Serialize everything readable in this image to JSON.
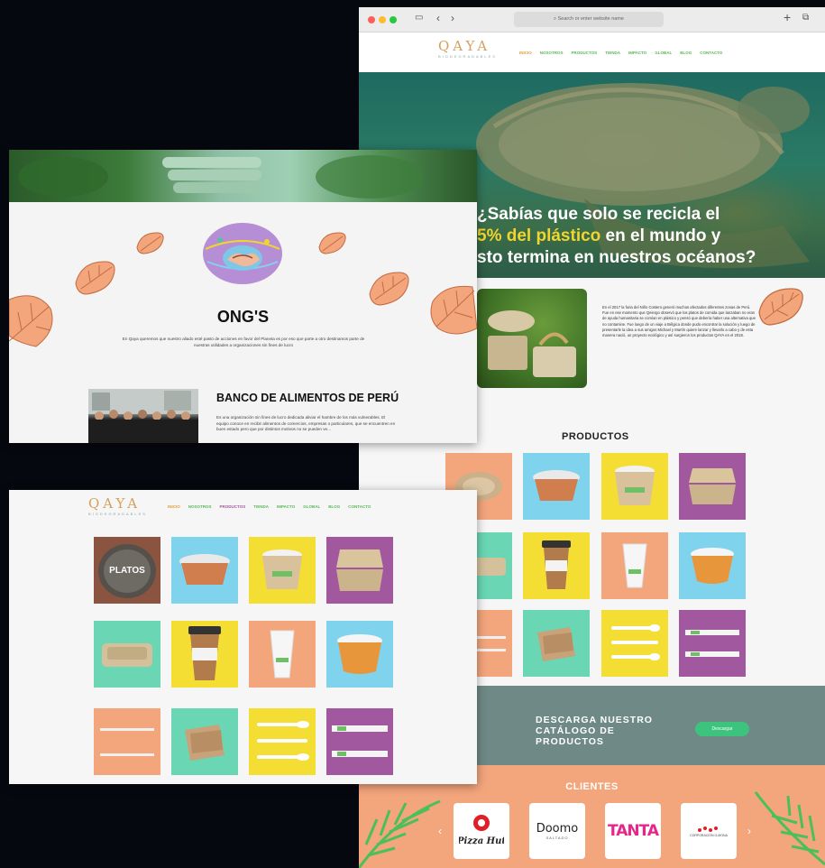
{
  "browser": {
    "address": "Search or enter website name",
    "icons": [
      "sidebar-icon",
      "back-icon",
      "forward-icon",
      "new-tab-icon",
      "tabs-overview-icon"
    ]
  },
  "site": {
    "logo": "QAYA",
    "logo_sub": "BIODEGRADABLES",
    "nav": [
      "INICIO",
      "NOSOTROS",
      "PRODUCTOS",
      "TIENDA",
      "IMPACTO",
      "GLOBAL",
      "BLOG",
      "CONTACTO"
    ],
    "accent": "#58b957",
    "accent_active": "#e69a34"
  },
  "hero": {
    "line1": "¿Sabías que solo se recicla el",
    "highlight": "5% del plástico",
    "line2_rest": " en el mundo y",
    "line3": "sto termina en nuestros océanos?",
    "highlight_color": "#f2d52c"
  },
  "about": {
    "text": "En el 2017 la furia del Niño Costero generó muchos afectados diferentes zonas de Perú. Fue en ese momento que Qeiergo observó que los platos de comida que lanzaban no eran de ayuda humanitaria se comían en plástico y pensó que debería haber una alternativa que no contamine. Fue luego de un viaje a Bélgica donde pudo encontrar la solución y luego de presentarle la idea a sus amigos Michael y Martín quiere lanzar y llevarlo a cabo y de esta manera nació, un proyecto ecológico y así surgieron los productos QAYA en el 2018."
  },
  "products": {
    "title": "PRODUCTOS",
    "platos_label": "PLATOS",
    "tile_colors": [
      "#f3a57c",
      "#7fd3ec",
      "#f5de33",
      "#a2589e",
      "#6ad6b4",
      "#f5de33",
      "#f3a57c",
      "#7fd3ec",
      "#f3a57c",
      "#6ad6b4",
      "#f5de33",
      "#a2589e"
    ]
  },
  "catalog": {
    "text": "DESCARGA NUESTRO\nCATÁLOGO DE\nPRODUCTOS",
    "button": "Descargar"
  },
  "clients": {
    "title": "CLIENTES",
    "logos": [
      "Pizza Hut",
      "Doomo",
      "Tanta",
      "Corporación G-Mona"
    ],
    "doomo_sub": "SALTADO",
    "tanta_logo": "TANTA",
    "corp_logo": "CORPORACIÓN G-MONA"
  },
  "ong": {
    "title": "ONG'S",
    "description": "En Qaya queremos que nuestro aliado esté pasto de acciones en favor del Planeta es por eso que parte a otro destinamos parte de nuestras utilidades a organizaciones sin fines de lucro",
    "subtitle": "BANCO DE ALIMENTOS DE PERÚ",
    "subtext": "Es una organización sin fines de lucro dedicada aliviar el hambre de los más vulnerables. El equipo conoce en recibir alimentos de comercios, empresas o particulares, que se encuentren en buen estado pero que por distintos motivos no se pueden ve..."
  }
}
